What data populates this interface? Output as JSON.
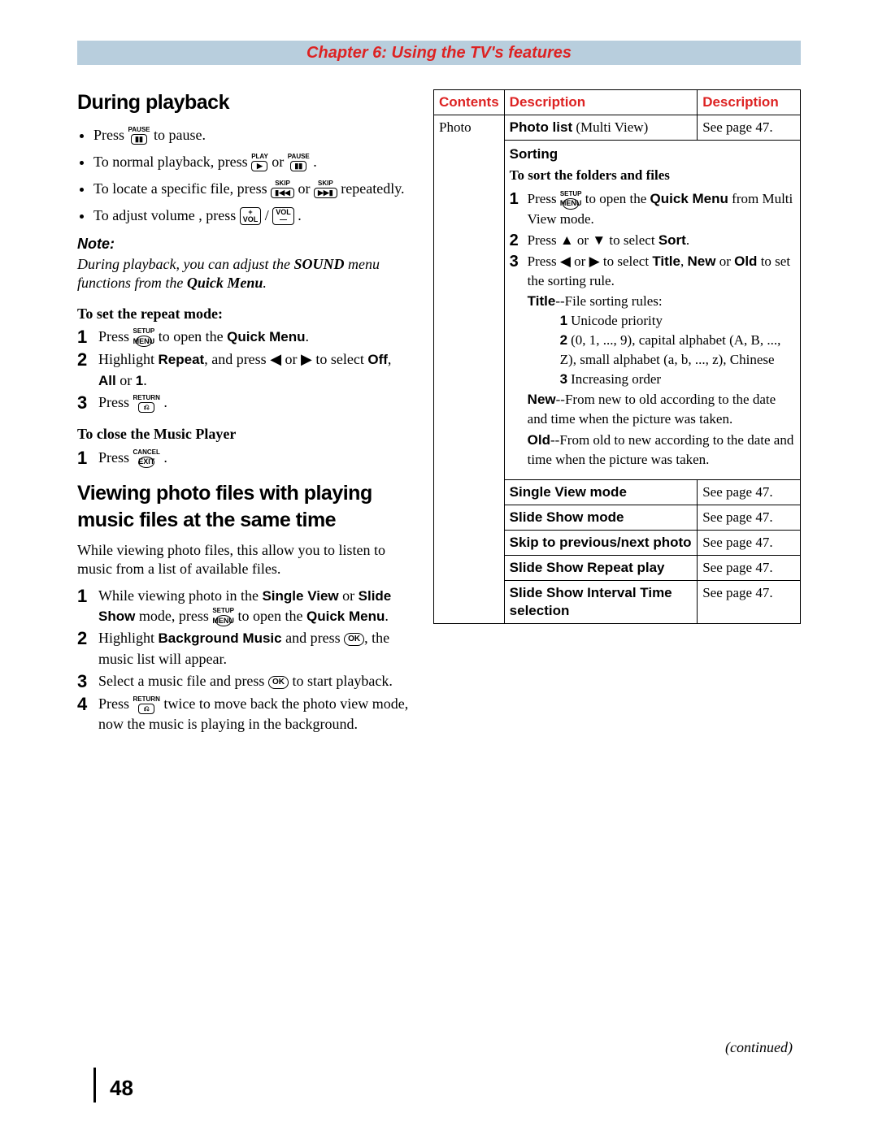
{
  "header": "Chapter 6: Using the TV's features",
  "left": {
    "h_playback": "During playback",
    "bullets": {
      "b1a": "Press ",
      "b1z": " to pause.",
      "b2a": "To normal playback, press ",
      "b2m": " or ",
      "b2z": ".",
      "b3a": "To locate a specific file, press ",
      "b3m": " or ",
      "b3z": " repeatedly.",
      "b4a": "To adjust volume , press ",
      "b4m": " / ",
      "b4z": "."
    },
    "note_head": "Note:",
    "note_body_a": "During playback, you can adjust the ",
    "note_body_b": "SOUND",
    "note_body_c": " menu functions from the ",
    "note_body_d": "Quick Menu",
    "note_body_e": ".",
    "sh_repeat": "To set the repeat mode:",
    "repeat_steps": {
      "s1a": "Press ",
      "s1b": " to open the ",
      "s1c": "Quick Menu",
      "s1d": ".",
      "s2a": "Highlight ",
      "s2b": "Repeat",
      "s2c": ", and press ",
      "s2d": " or ",
      "s2e": " to select ",
      "s2f": "Off",
      "s2g": ", ",
      "s2h": "All",
      "s2i": " or ",
      "s2j": "1",
      "s2k": ".",
      "s3a": "Press ",
      "s3b": "."
    },
    "sh_close": "To close the Music Player",
    "close_step_a": "Press ",
    "close_step_b": " .",
    "h_viewing": "Viewing photo files with playing music files at the same time",
    "viewing_intro": "While viewing photo files, this allow you to listen to music from a list of available files.",
    "viewing_steps": {
      "v1a": "While viewing photo in the ",
      "v1b": "Single View",
      "v1c": " or ",
      "v1d": "Slide Show",
      "v1e": " mode, press ",
      "v1f": " to open the ",
      "v1g": "Quick Menu",
      "v1h": ".",
      "v2a": "Highlight ",
      "v2b": "Background Music",
      "v2c": " and press ",
      "v2d": ", the music list will appear.",
      "v3a": "Select a music file and press ",
      "v3b": " to start playback.",
      "v4a": "Press ",
      "v4b": " twice to move back the photo view mode, now the music is playing in the background."
    },
    "btns": {
      "pause": "PAUSE",
      "pause_glyph": "▮▮",
      "play": "PLAY",
      "play_glyph": "▶",
      "skip": "SKIP",
      "skip_prev": "▮◀◀",
      "skip_next": "▶▶▮",
      "volp": "+",
      "volp_sub": "VOL",
      "volm": "VOL",
      "volm_sub": "—",
      "setup": "SETUP",
      "menu": "MENU",
      "return": "RETURN",
      "return_glyph": "⎌",
      "cancel": "CANCEL",
      "exit": "EXIT",
      "left": "◀",
      "right": "▶",
      "up": "▲",
      "down": "▼",
      "ok": "OK"
    }
  },
  "table": {
    "th1": "Contents",
    "th2": "Description",
    "th3": "Description",
    "photo": "Photo",
    "row1_a": "Photo list",
    "row1_b": " (Multi View)",
    "row1_ref": "See page 47.",
    "sorting_h": "Sorting",
    "sorting_sub": "To sort the folders and files",
    "s1a": "Press ",
    "s1b": " to open the ",
    "s1c": "Quick Menu",
    "s1d": " from Multi View mode.",
    "s2a": "Press ",
    "s2b": " or ",
    "s2c": " to select ",
    "s2d": "Sort",
    "s2e": ".",
    "s3a": "Press ",
    "s3b": " or ",
    "s3c": " to select ",
    "s3d": "Title",
    "s3e": ", ",
    "s3f": "New",
    "s3g": " or ",
    "s3h": "Old",
    "s3i": " to set the sorting rule.",
    "title_lbl": "Title",
    "title_tail": "--File sorting rules:",
    "tr1": "Unicode priority",
    "tr2": "(0, 1, ..., 9), capital alphabet (A, B, ..., Z), small alphabet (a, b, ..., z), Chinese",
    "tr3": "Increasing order",
    "new_lbl": "New",
    "new_tail": "--From new to old according to the date and time when the picture was taken.",
    "old_lbl": "Old",
    "old_tail": "--From old to new according to the date and time when the picture was taken.",
    "r3": "Single View mode",
    "r3ref": "See page 47.",
    "r4": "Slide Show mode",
    "r4ref": "See page 47.",
    "r5": "Skip to previous/next photo",
    "r5ref": "See page 47.",
    "r6": "Slide Show Repeat play",
    "r6ref": "See page 47.",
    "r7": "Slide Show Interval Time selection",
    "r7ref": "See page 47."
  },
  "continued": "(continued)",
  "page_number": "48"
}
